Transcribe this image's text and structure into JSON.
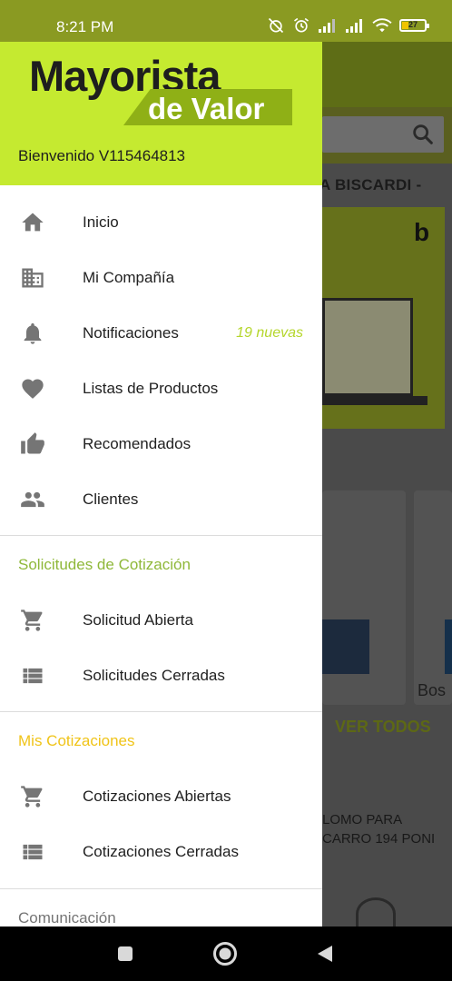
{
  "status_bar": {
    "time": "8:21 PM",
    "battery": "27",
    "icons": [
      "alarm-off-icon",
      "alarm-icon",
      "signal-icon",
      "signal-icon",
      "wifi-icon",
      "battery-icon"
    ]
  },
  "background": {
    "banner_title": "A BISCARDI -",
    "card_text": "Bos",
    "ver_todos": "VER TODOS",
    "product_text": "LOMO PARA CARRO 194 PONI",
    "brand_mark": "b"
  },
  "drawer": {
    "logo": {
      "top": "Mayorista",
      "bottom": "de Valor"
    },
    "welcome": "Bienvenido V115464813",
    "items": [
      {
        "label": "Inicio",
        "icon": "home-icon"
      },
      {
        "label": "Mi Compañía",
        "icon": "building-icon"
      },
      {
        "label": "Notificaciones",
        "icon": "bell-icon",
        "badge": "19 nuevas"
      },
      {
        "label": "Listas de Productos",
        "icon": "heart-icon"
      },
      {
        "label": "Recomendados",
        "icon": "thumb-up-icon"
      },
      {
        "label": "Clientes",
        "icon": "people-icon"
      }
    ],
    "section_quotes_requests": {
      "title": "Solicitudes de Cotización",
      "items": [
        {
          "label": "Solicitud Abierta",
          "icon": "cart-icon"
        },
        {
          "label": "Solicitudes Cerradas",
          "icon": "list-icon"
        }
      ]
    },
    "section_my_quotes": {
      "title": "Mis Cotizaciones",
      "items": [
        {
          "label": "Cotizaciones Abiertas",
          "icon": "cart-icon"
        },
        {
          "label": "Cotizaciones Cerradas",
          "icon": "list-icon"
        }
      ]
    },
    "section_communication": {
      "title": "Comunicación"
    }
  },
  "colors": {
    "brand_green": "#c5ea30",
    "brand_dark_green": "#8fb016",
    "section_green": "#8fb83a",
    "section_yellow": "#f0c419",
    "badge_green": "#b5d62c"
  },
  "nav_bar": {
    "buttons": [
      "recents-button",
      "home-button",
      "back-button"
    ]
  }
}
